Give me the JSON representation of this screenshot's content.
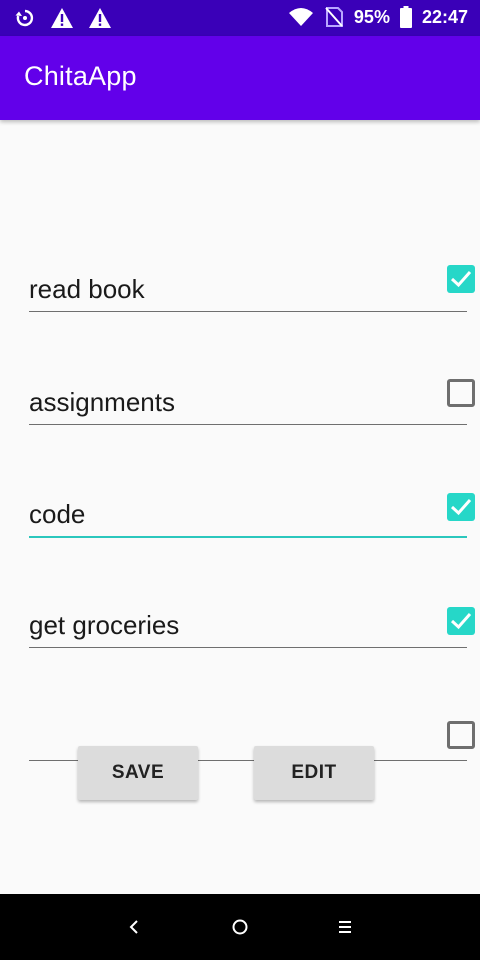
{
  "status_bar": {
    "left_icons": [
      "sync-icon",
      "warning-icon",
      "warning-icon"
    ],
    "wifi_icon": "wifi-icon",
    "signal_icon": "no-signal-icon",
    "battery_percent": "95%",
    "battery_icon": "battery-icon",
    "time": "22:47"
  },
  "app_bar": {
    "title": "ChitaApp"
  },
  "tasks": [
    {
      "text": "read book",
      "checked": true,
      "focused": false
    },
    {
      "text": "assignments",
      "checked": false,
      "focused": false
    },
    {
      "text": "code",
      "checked": true,
      "focused": true
    },
    {
      "text": "get groceries",
      "checked": true,
      "focused": false
    },
    {
      "text": "",
      "checked": false,
      "focused": false
    }
  ],
  "buttons": {
    "save_label": "SAVE",
    "edit_label": "EDIT"
  },
  "nav_bar": {
    "icons": [
      "back-icon",
      "home-icon",
      "recents-icon"
    ]
  },
  "colors": {
    "status_bar": "#3a00b8",
    "app_bar": "#6200ea",
    "accent": "#26d7c8",
    "focus_underline": "#2bc7bd"
  }
}
